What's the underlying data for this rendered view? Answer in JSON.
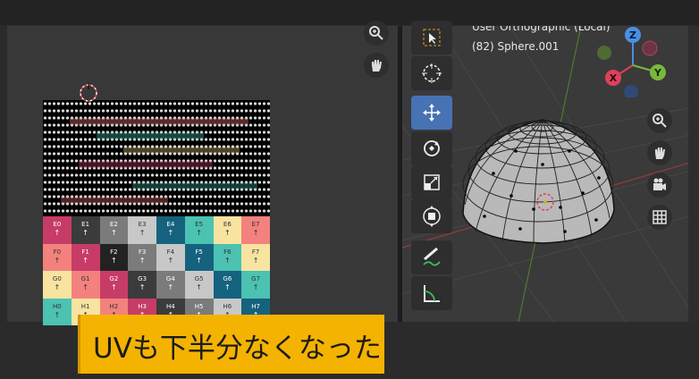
{
  "viewport": {
    "view_name": "User Orthographic (Local)",
    "object_info": "(82) Sphere.001",
    "gizmo": {
      "z": "Z",
      "x": "X",
      "y": "Y"
    }
  },
  "uv_editor": {
    "texture_rows": [
      [
        "E0",
        "E1",
        "E2",
        "E3",
        "E4",
        "E5",
        "E6",
        "E7"
      ],
      [
        "F0",
        "F1",
        "F2",
        "F3",
        "F4",
        "F5",
        "F6",
        "F7"
      ],
      [
        "G0",
        "G1",
        "G2",
        "G3",
        "G4",
        "G5",
        "G6",
        "G7"
      ],
      [
        "H0",
        "H1",
        "H2",
        "H3",
        "H4",
        "H5",
        "H6",
        "H7"
      ]
    ],
    "texture_colors": [
      [
        "#c73c67",
        "#3b3b3b",
        "#7b7b7b",
        "#c8c8c8",
        "#15627e",
        "#4bc2b2",
        "#f8e4a0",
        "#f3817d"
      ],
      [
        "#f3817d",
        "#c73c67",
        "#222222",
        "#7b7b7b",
        "#c8c8c8",
        "#15627e",
        "#4bc2b2",
        "#f8e4a0"
      ],
      [
        "#f8e4a0",
        "#f3817d",
        "#c73c67",
        "#3b3b3b",
        "#7b7b7b",
        "#c8c8c8",
        "#15627e",
        "#4bc2b2"
      ],
      [
        "#4bc2b2",
        "#f8e4a0",
        "#f3817d",
        "#c73c67",
        "#3b3b3b",
        "#7b7b7b",
        "#c8c8c8",
        "#15627e"
      ]
    ],
    "arrow": "↑"
  },
  "caption": {
    "text": "UVも下半分なくなった"
  },
  "colors": {
    "accent": "#4772b3",
    "caption_bg": "#f4b300"
  }
}
